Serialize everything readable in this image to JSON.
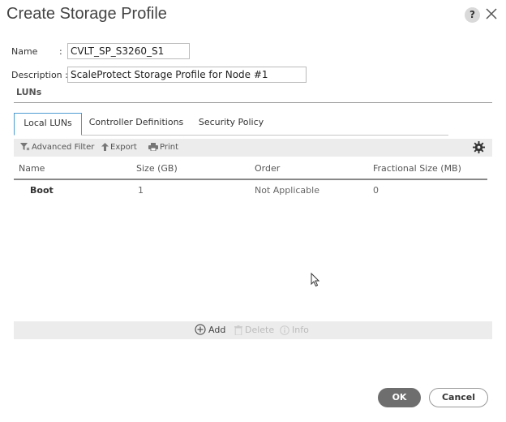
{
  "dialog": {
    "title": "Create Storage Profile",
    "help_label": "?"
  },
  "form": {
    "name_label": "Name",
    "name_colon": ":",
    "name_value": "CVLT_SP_S3260_S1",
    "description_label": "Description :",
    "description_value": "ScaleProtect Storage Profile for Node #1"
  },
  "section": {
    "title": "LUNs"
  },
  "tabs": [
    {
      "label": "Local LUNs",
      "active": true
    },
    {
      "label": "Controller Definitions",
      "active": false
    },
    {
      "label": "Security Policy",
      "active": false
    }
  ],
  "toolbar": {
    "advanced_filter": "Advanced Filter",
    "export": "Export",
    "print": "Print"
  },
  "table": {
    "columns": [
      "Name",
      "Size (GB)",
      "Order",
      "Fractional Size (MB)"
    ],
    "rows": [
      [
        "Boot",
        "1",
        "Not Applicable",
        "0"
      ]
    ]
  },
  "actions": {
    "add": "Add",
    "delete": "Delete",
    "info": "Info"
  },
  "footer": {
    "ok": "OK",
    "cancel": "Cancel"
  },
  "colors": {
    "tab_active_border": "#4c9cd0",
    "ok_bg": "#6e6e6e",
    "toolbar_bg": "#ececec"
  }
}
